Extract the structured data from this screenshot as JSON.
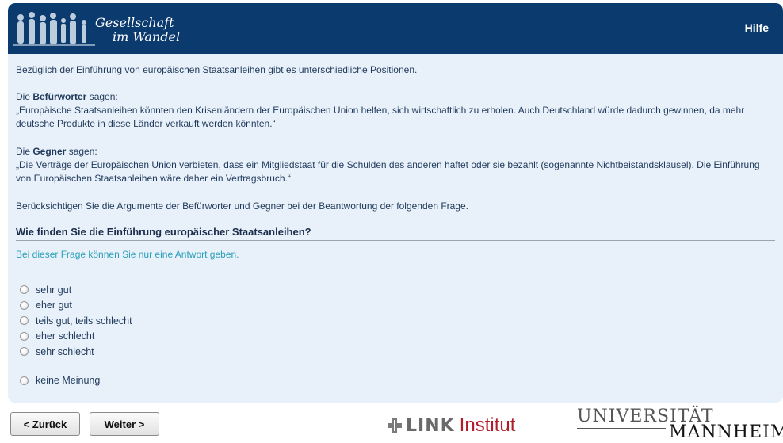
{
  "header": {
    "logo_line1": "Gesellschaft",
    "logo_line2": "im Wandel",
    "help_label": "Hilfe",
    "bg_color": "#0b3a6e"
  },
  "text": {
    "intro": "Bezüglich der Einführung von europäischen Staatsanleihen gibt es unterschiedliche Positionen.",
    "pro_prefix": "Die ",
    "pro_bold": "Befürworter",
    "pro_suffix": " sagen:",
    "pro_quote": "„Europäische Staatsanleihen könnten den Krisenländern der Europäischen Union helfen, sich wirtschaftlich zu erholen. Auch Deutschland würde dadurch gewinnen, da mehr deutsche Produkte in diese Länder verkauft werden könnten.“",
    "con_prefix": "Die ",
    "con_bold": "Gegner",
    "con_suffix": " sagen:",
    "con_quote": "„Die Verträge der Europäischen Union verbieten, dass ein Mitgliedstaat für die Schulden des anderen haftet oder sie bezahlt (sogenannte Nichtbeistandsklausel). Die Einführung von Europäischen Staatsanleihen wäre daher ein Vertragsbruch.“",
    "consider": "Berücksichtigen Sie die Argumente der Befürworter und Gegner bei der Beantwortung der folgenden Frage.",
    "question": "Wie finden Sie die Einführung europäischer Staatsanleihen?",
    "hint": "Bei dieser Frage können Sie nur eine Antwort geben."
  },
  "options": [
    "sehr gut",
    "eher gut",
    "teils gut, teils schlecht",
    "eher schlecht",
    "sehr schlecht"
  ],
  "option_no_opinion": "keine Meinung",
  "nav": {
    "back_label": "< Zurück",
    "next_label": "Weiter >"
  },
  "footer": {
    "link_word": "LINK",
    "link_institut": "Institut",
    "uni_line1": "UNIVERSITÄT",
    "uni_line2": "MANNHEIM"
  }
}
